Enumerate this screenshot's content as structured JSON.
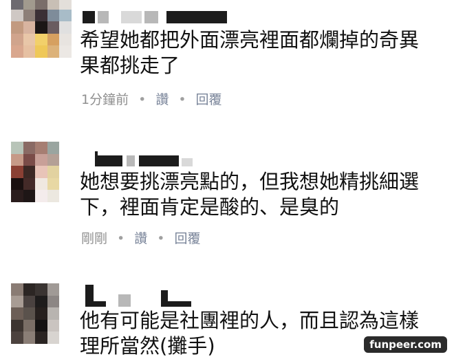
{
  "comments": [
    {
      "text": "希望她都把外面漂亮裡面都爛掉的奇異果都挑走了",
      "time": "1分鐘前",
      "like_label": "讚",
      "reply_label": "回覆",
      "separator": "•"
    },
    {
      "text": "她想要挑漂亮點的，但我想她精挑細選下，裡面肯定是酸的、是臭的",
      "time": "剛剛",
      "like_label": "讚",
      "reply_label": "回覆",
      "separator": "•"
    },
    {
      "text": "他有可能是社團裡的人，而且認為這樣理所當然(攤手)",
      "time": "",
      "like_label": "",
      "reply_label": "",
      "separator": ""
    }
  ],
  "watermark": "funpeer.com",
  "avatar_colors": {
    "a1": [
      "#6d6a70",
      "#a19a8e",
      "#7a6e6a",
      "#c8bfb5",
      "#e3dfda",
      "#cfc8c4",
      "#8d7f78",
      "#3b3036",
      "#7e8c9a",
      "#a8bcc8",
      "#c29a80",
      "#d8b4a0",
      "#1b1616",
      "#6a5c60",
      "#e0e0e0",
      "#d0a48c",
      "#e8c6a8",
      "#f2d06a",
      "#d6a060",
      "#e8e4e0",
      "#d9a78e",
      "#e6c0a2",
      "#efc858",
      "#dcb27a",
      "#ece8e4"
    ],
    "a2": [
      "#b8c4b8",
      "#8a6a64",
      "#a67e72",
      "#9aa5a0",
      "#ffffff",
      "#c69a88",
      "#7a4c48",
      "#c8a098",
      "#b4a096",
      "#ffffff",
      "#8a4034",
      "#3c2824",
      "#e8c4b8",
      "#e2d2a0",
      "#ffffff",
      "#1a1010",
      "#442a28",
      "#f0e8e0",
      "#e8d8a4",
      "#ffffff",
      "#2a1c1c",
      "#1e1616",
      "#f4ecec",
      "#ece8e0",
      "#ffffff"
    ],
    "a3": [
      "#8a7c74",
      "#2c2624",
      "#3a3432",
      "#a09a96",
      "#ffffff",
      "#a89c94",
      "#4a4240",
      "#1e1c1c",
      "#8c8684",
      "#ffffff",
      "#6c5e56",
      "#5a524c",
      "#26201e",
      "#b8b4b0",
      "#ffffff",
      "#3c3430",
      "#7a6e66",
      "#141212",
      "#cac4c0",
      "#ffffff",
      "#4c423e",
      "#8a7e76",
      "#2a2422",
      "#d8d4d0",
      "#ffffff"
    ]
  }
}
